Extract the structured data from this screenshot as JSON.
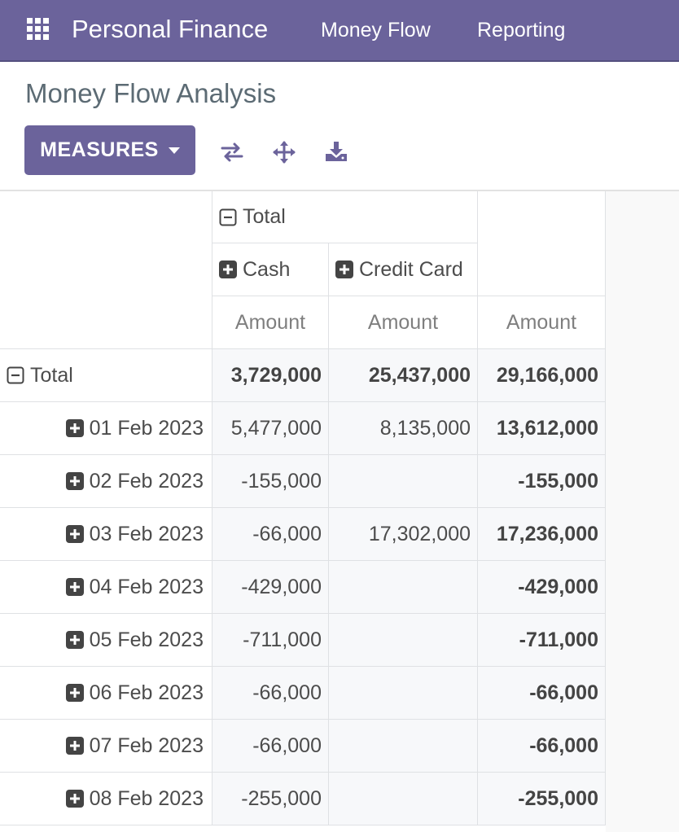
{
  "navbar": {
    "apps_icon": "grid-apps-icon",
    "brand": "Personal Finance",
    "menus": [
      "Money Flow",
      "Reporting"
    ]
  },
  "control_panel": {
    "title": "Money Flow Analysis",
    "measures_label": "MEASURES",
    "tools": [
      "flip-axis-icon",
      "expand-all-icon",
      "download-icon"
    ]
  },
  "pivot": {
    "col_group_total": "Total",
    "col_groups": [
      "Cash",
      "Credit Card"
    ],
    "measure_label": "Amount",
    "row_total_label": "Total",
    "total_row": [
      "3,729,000",
      "25,437,000",
      "29,166,000"
    ],
    "rows": [
      {
        "label": "01 Feb 2023",
        "cash": "5,477,000",
        "credit_card": "8,135,000",
        "total": "13,612,000"
      },
      {
        "label": "02 Feb 2023",
        "cash": "-155,000",
        "credit_card": "",
        "total": "-155,000"
      },
      {
        "label": "03 Feb 2023",
        "cash": "-66,000",
        "credit_card": "17,302,000",
        "total": "17,236,000"
      },
      {
        "label": "04 Feb 2023",
        "cash": "-429,000",
        "credit_card": "",
        "total": "-429,000"
      },
      {
        "label": "05 Feb 2023",
        "cash": "-711,000",
        "credit_card": "",
        "total": "-711,000"
      },
      {
        "label": "06 Feb 2023",
        "cash": "-66,000",
        "credit_card": "",
        "total": "-66,000"
      },
      {
        "label": "07 Feb 2023",
        "cash": "-66,000",
        "credit_card": "",
        "total": "-66,000"
      },
      {
        "label": "08 Feb 2023",
        "cash": "-255,000",
        "credit_card": "",
        "total": "-255,000"
      }
    ]
  },
  "colors": {
    "brand": "#6b639b",
    "cell_bg": "#f7f8fa",
    "border": "#dfe1e4",
    "icon": "#444444"
  }
}
